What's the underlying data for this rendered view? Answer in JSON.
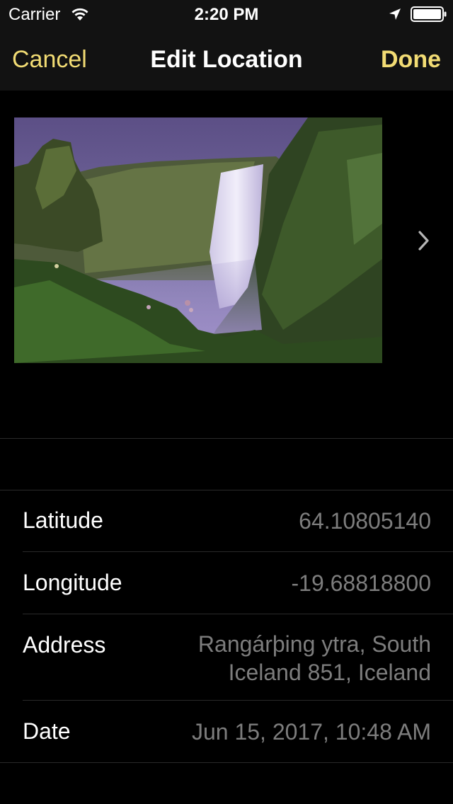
{
  "status_bar": {
    "carrier": "Carrier",
    "time": "2:20 PM",
    "icons": [
      "wifi-icon",
      "location-arrow-icon",
      "battery-icon"
    ]
  },
  "nav": {
    "cancel_label": "Cancel",
    "title": "Edit Location",
    "done_label": "Done"
  },
  "photo": {
    "subject": "waterfall-photo",
    "next_icon": "chevron-right-icon"
  },
  "details": {
    "latitude": {
      "label": "Latitude",
      "value": "64.10805140"
    },
    "longitude": {
      "label": "Longitude",
      "value": "-19.68818800"
    },
    "address": {
      "label": "Address",
      "value_line1": "Rangárþing ytra, South",
      "value_line2": "Iceland 851, Iceland"
    },
    "date": {
      "label": "Date",
      "value": "Jun 15, 2017, 10:48 AM"
    }
  },
  "colors": {
    "accent": "#f2dc74",
    "bar_background": "#121212",
    "secondary_text": "#7d7d7d",
    "separator": "#2a2a2a"
  }
}
